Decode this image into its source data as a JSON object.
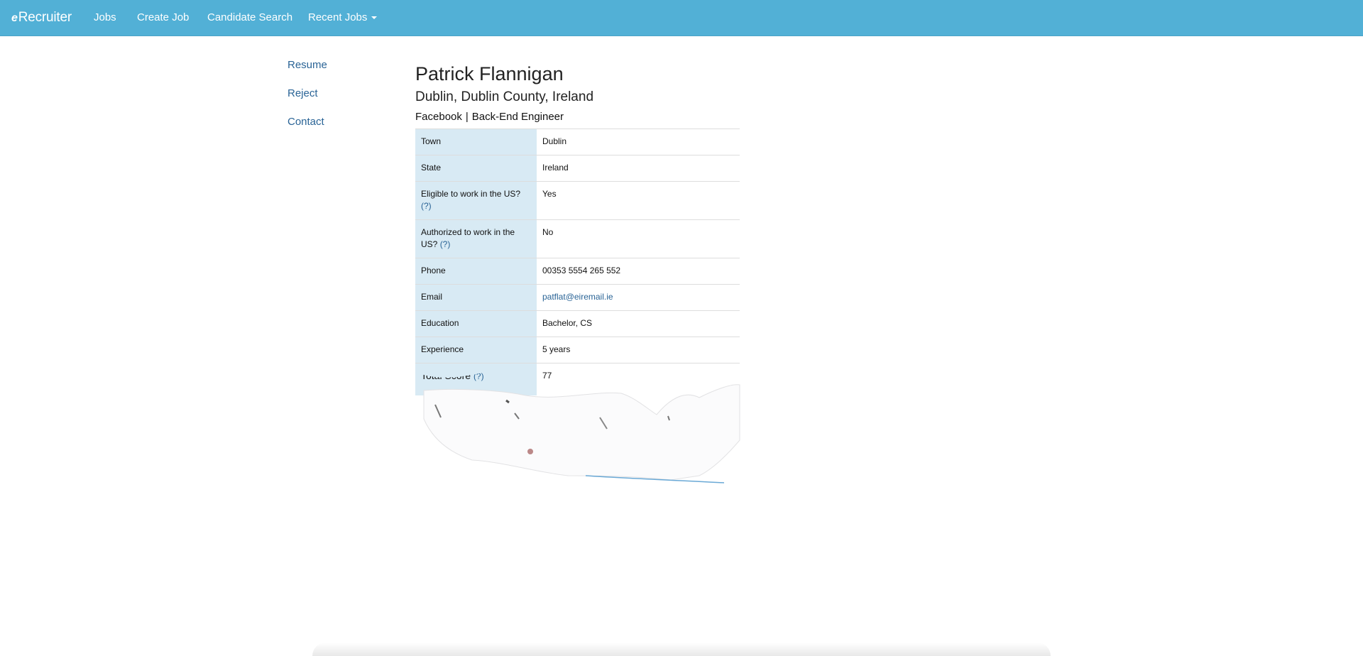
{
  "navbar": {
    "brand_e": "e",
    "brand_rest": "Recruiter",
    "items": [
      {
        "label": "Jobs"
      },
      {
        "label": "Create Job"
      },
      {
        "label": "Candidate Search"
      },
      {
        "label": "Recent Jobs"
      }
    ]
  },
  "sidebar": {
    "links": [
      {
        "label": "Resume"
      },
      {
        "label": "Reject"
      },
      {
        "label": "Contact"
      }
    ]
  },
  "candidate": {
    "name": "Patrick Flannigan",
    "location": "Dublin, Dublin County, Ireland",
    "company": "Facebook",
    "separator": "|",
    "role": "Back-End Engineer",
    "help_marker": "(?)",
    "details": [
      {
        "label": "Town",
        "value": "Dublin"
      },
      {
        "label": "State",
        "value": "Ireland"
      },
      {
        "label": "Eligible to work in the US?",
        "value": "Yes"
      },
      {
        "label": "Authorized to work in the US?",
        "value": "No"
      },
      {
        "label": "Phone",
        "value": "00353 5554 265 552"
      },
      {
        "label": "Email",
        "value": "patflat@eiremail.ie"
      },
      {
        "label": "Education",
        "value": "Bachelor, CS"
      },
      {
        "label": "Experience",
        "value": "5 years"
      },
      {
        "label": "Total Score",
        "value": "77"
      }
    ]
  },
  "colors": {
    "navbar": "#52b0d6",
    "link": "#2a6496",
    "label_cell": "#d8eaf4"
  }
}
